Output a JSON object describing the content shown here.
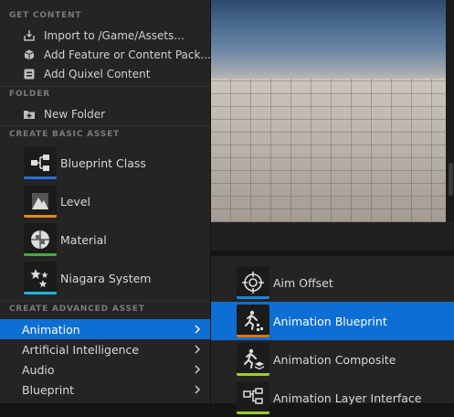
{
  "sections": {
    "get_content": "GET CONTENT",
    "folder": "FOLDER",
    "create_basic": "CREATE BASIC ASSET",
    "create_advanced": "CREATE ADVANCED ASSET"
  },
  "get_content_items": [
    {
      "label": "Import to /Game/Assets...",
      "icon": "import-icon"
    },
    {
      "label": "Add Feature or Content Pack...",
      "icon": "content-pack-icon"
    },
    {
      "label": "Add Quixel Content",
      "icon": "quixel-icon"
    }
  ],
  "folder_items": [
    {
      "label": "New Folder",
      "icon": "new-folder-icon"
    }
  ],
  "basic_assets": [
    {
      "label": "Blueprint Class",
      "icon": "blueprint-class-icon",
      "color": "#2e6bd4"
    },
    {
      "label": "Level",
      "icon": "level-icon",
      "color": "#e08a1e"
    },
    {
      "label": "Material",
      "icon": "material-icon",
      "color": "#3fae3c"
    },
    {
      "label": "Niagara System",
      "icon": "niagara-system-icon",
      "color": "#1fb5dc"
    }
  ],
  "advanced_categories": [
    {
      "label": "Animation",
      "active": true
    },
    {
      "label": "Artificial Intelligence",
      "active": false
    },
    {
      "label": "Audio",
      "active": false
    },
    {
      "label": "Blueprint",
      "active": false
    }
  ],
  "animation_submenu": [
    {
      "label": "Aim Offset",
      "icon": "aim-offset-icon",
      "color": "#1e88d4",
      "active": false
    },
    {
      "label": "Animation Blueprint",
      "icon": "animation-blueprint-icon",
      "color": "#d4761e",
      "active": true
    },
    {
      "label": "Animation Composite",
      "icon": "animation-composite-icon",
      "color": "#9ccc2c",
      "active": false
    },
    {
      "label": "Animation Layer Interface",
      "icon": "animation-layer-interface-icon",
      "color": "#9ccc2c",
      "active": false
    }
  ]
}
